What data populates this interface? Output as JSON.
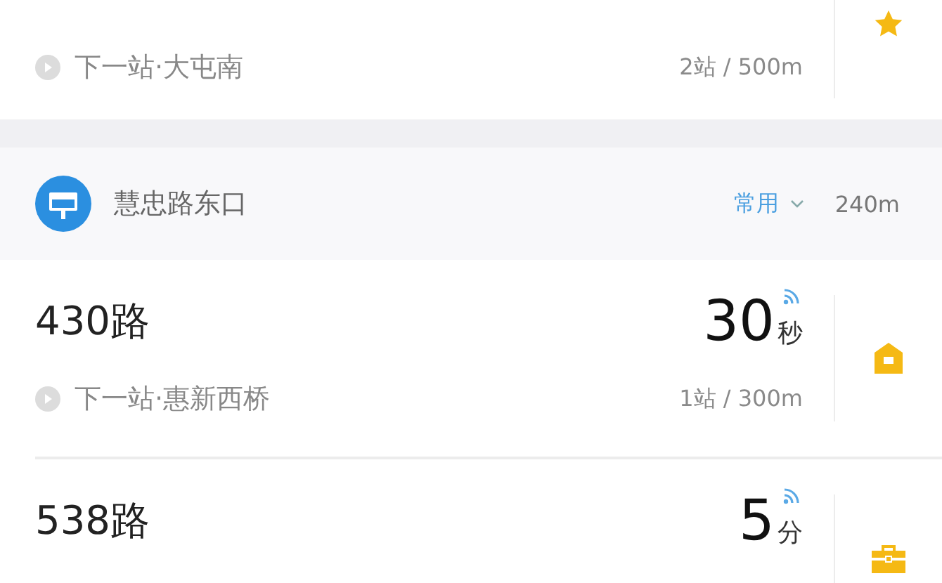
{
  "top_card": {
    "next_stop": "下一站·大屯南",
    "distance": "2站 / 500m",
    "tag": {
      "kind": "star"
    }
  },
  "station": {
    "name": "慧忠路东口",
    "filter": "常用",
    "distance": "240m"
  },
  "routes": [
    {
      "name": "430路",
      "time": "30",
      "unit": "秒",
      "realtime": true,
      "next_stop": "下一站·惠新西桥",
      "distance": "1站 / 300m",
      "tag": {
        "kind": "home"
      }
    },
    {
      "name": "538路",
      "time": "5",
      "unit": "分",
      "realtime": true,
      "tag": {
        "kind": "work"
      }
    }
  ]
}
